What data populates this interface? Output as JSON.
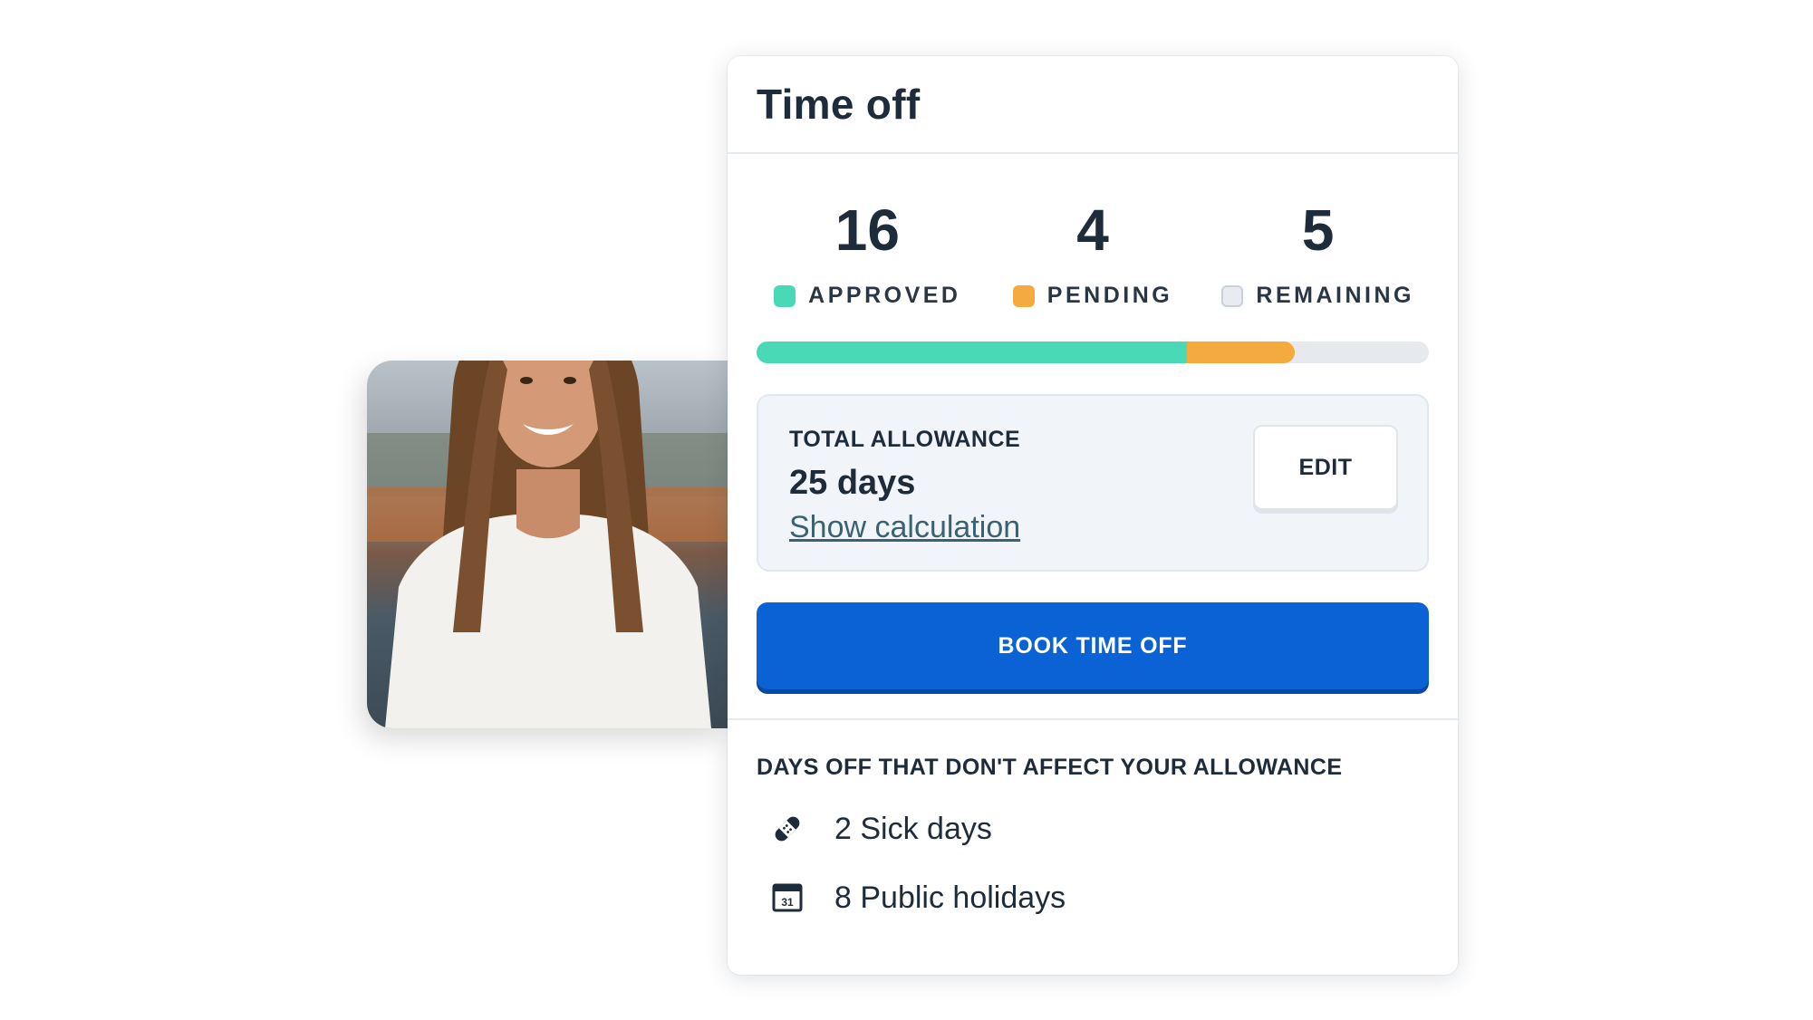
{
  "card": {
    "title": "Time off"
  },
  "stats": [
    {
      "value": "16",
      "label": "APPROVED"
    },
    {
      "value": "4",
      "label": "PENDING"
    },
    {
      "value": "5",
      "label": "REMAINING"
    }
  ],
  "progress": {
    "approved_fraction": 0.64,
    "pending_fraction": 0.16,
    "remaining_fraction": 0.2
  },
  "allowance": {
    "label": "TOTAL ALLOWANCE",
    "value": "25 days",
    "link": "Show calculation",
    "edit_label": "EDIT"
  },
  "book_button": "BOOK TIME OFF",
  "other_days": {
    "title": "DAYS OFF THAT DON'T AFFECT YOUR ALLOWANCE",
    "items": [
      {
        "icon": "bandage-icon",
        "text": "2 Sick days"
      },
      {
        "icon": "calendar-icon",
        "text": "8 Public holidays"
      }
    ],
    "calendar_icon_number": "31"
  },
  "colors": {
    "approved": "#4ad9b7",
    "pending": "#f4aa3c",
    "remaining": "#e6e9ed",
    "primary": "#0b62d4"
  }
}
